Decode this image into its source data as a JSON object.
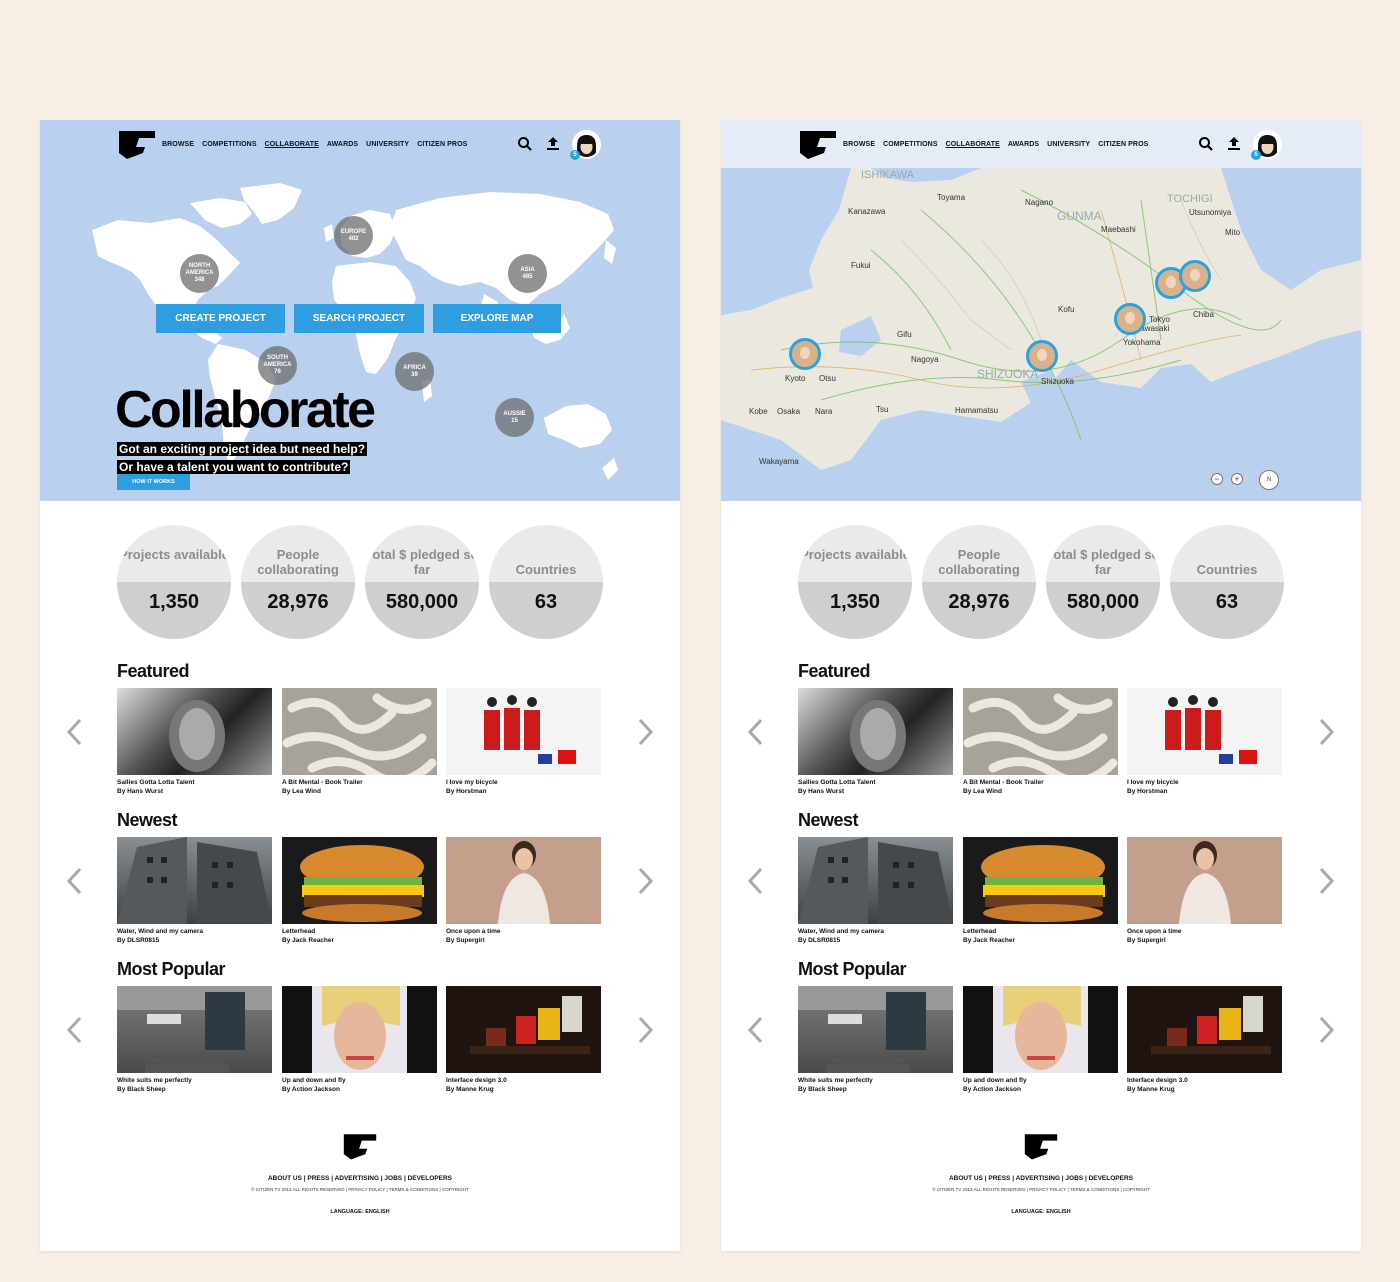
{
  "nav": {
    "links": [
      "BROWSE",
      "COMPETITIONS",
      "COLLABORATE",
      "AWARDS",
      "UNIVERSITY",
      "CITIZEN PROS"
    ],
    "notification_count": "5"
  },
  "hero_world": {
    "regions": [
      {
        "name": "NORTH AMERICA",
        "count": "348"
      },
      {
        "name": "EUROPE",
        "count": "402"
      },
      {
        "name": "ASIA",
        "count": "485"
      },
      {
        "name": "SOUTH AMERICA",
        "count": "76"
      },
      {
        "name": "AFRICA",
        "count": "39"
      },
      {
        "name": "AUSSIE",
        "count": "15"
      }
    ],
    "buttons": [
      "CREATE PROJECT",
      "SEARCH PROJECT",
      "EXPLORE MAP"
    ],
    "title": "Collaborate",
    "subtitle_line1": "Got an exciting project idea but need help?",
    "subtitle_line2": "Or have a talent you want to contribute?",
    "how_it_works": "HOW IT WORKS"
  },
  "hero_map": {
    "places": [
      "ISHIKAWA",
      "Toyama",
      "Nagano",
      "Kanazawa",
      "Fukui",
      "GUNMA",
      "TOCHIGI",
      "Utsunomiya",
      "Maebashi",
      "Mito",
      "Kofu",
      "Tokyo",
      "Chiba",
      "Kawasaki",
      "Yokohama",
      "Gifu",
      "Nagoya",
      "Kyoto",
      "Otsu",
      "Osaka",
      "Kobe",
      "Nara",
      "Tsu",
      "Shizuoka",
      "Hamamatsu",
      "Wakayama",
      "SHIZUOKA"
    ],
    "zoom_out": "−",
    "zoom_in": "+",
    "compass": "N"
  },
  "stats": [
    {
      "label": "Projects available",
      "value": "1,350"
    },
    {
      "label": "People collaborating",
      "value": "28,976"
    },
    {
      "label": "Total $ pledged so far",
      "value": "580,000"
    },
    {
      "label": "Countries",
      "value": "63"
    }
  ],
  "sections": [
    {
      "title": "Featured",
      "items": [
        {
          "title": "Sallies Gotta Lotta Talent",
          "author": "By Hans Wurst"
        },
        {
          "title": "A Bit Mental - Book Trailer",
          "author": "By Lea Wind"
        },
        {
          "title": "I love my bicycle",
          "author": "By Horstman"
        }
      ]
    },
    {
      "title": "Newest",
      "items": [
        {
          "title": "Water, Wind and my camera",
          "author": "By DLSR0815"
        },
        {
          "title": "Letterhead",
          "author": "By Jack Reacher"
        },
        {
          "title": "Once upon a time",
          "author": "By Supergirl"
        }
      ]
    },
    {
      "title": "Most Popular",
      "items": [
        {
          "title": "White suits me perfectly",
          "author": "By Black Sheep"
        },
        {
          "title": "Up and down and fly",
          "author": "By Action Jackson"
        },
        {
          "title": "Interface design 3.0",
          "author": "By Manne Krug"
        }
      ]
    }
  ],
  "footer": {
    "links": "ABOUT US | PRESS | ADVERTISING | JOBS | DEVELOPERS",
    "copyright": "© CITIZEN TV 2013 ALL RIGHTS RESERVED | PRIVACY POLICY | TERMS & CONDITIONS | COPYRIGHT",
    "language": "LANGUAGE: ENGLISH"
  },
  "colors": {
    "accent": "#2e9ee0",
    "hero_bg": "#b9d0ee",
    "page_bg": "#f7efe5"
  }
}
